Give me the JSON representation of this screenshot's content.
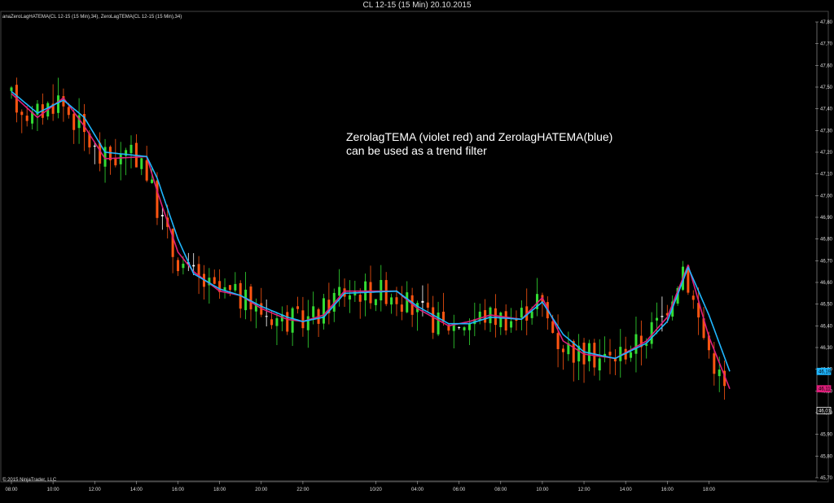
{
  "window": {
    "title": "CL 12-15 (15 Min)  20.10.2015"
  },
  "indicator_label": "anaZeroLagHATEMA(CL 12-15 (15 Min),34), ZeroLagTEMA(CL 12-15 (15 Min),34)",
  "copyright": "© 2015 NinjaTrader, LLC",
  "annotation": {
    "line1": "ZerolagTEMA (violet red) and ZerolagHATEMA(blue)",
    "line2": "can be used as a trend filter"
  },
  "colors": {
    "background": "#000000",
    "up_candle": "#33dd33",
    "down_candle": "#ff5511",
    "doji_candle": "#ffffff",
    "tema_line": "#dd1f7a",
    "hatema_line": "#1fb6ff",
    "axis": "#aaaaaa"
  },
  "price_markers": [
    {
      "label": "46,19",
      "value": 46.19,
      "color": "#1fb6ff"
    },
    {
      "label": "46,11",
      "value": 46.11,
      "color": "#dd1f7a"
    },
    {
      "label": "46,01",
      "value": 46.01,
      "color": "#ffffff"
    }
  ],
  "chart_data": {
    "type": "candlestick",
    "title": "CL 12-15 (15 Min)  20.10.2015",
    "ylim": [
      45.7,
      47.8
    ],
    "y_ticks": [
      "47,80",
      "47,70",
      "47,60",
      "47,50",
      "47,40",
      "47,30",
      "47,20",
      "47,10",
      "47,00",
      "46,90",
      "46,80",
      "46,70",
      "46,60",
      "46,50",
      "46,40",
      "46,30",
      "46,20",
      "46,10",
      "46,00",
      "45,90",
      "45,80",
      "45,70"
    ],
    "x_ticks": [
      "08:00",
      "10:00",
      "12:00",
      "14:00",
      "16:00",
      "18:00",
      "20:00",
      "22:00",
      "10/20",
      "04:00",
      "06:00",
      "08:00",
      "10:00",
      "12:00",
      "14:00",
      "16:00",
      "18:00"
    ],
    "x_tick_bars": [
      0,
      8,
      16,
      24,
      32,
      40,
      48,
      56,
      70,
      78,
      86,
      94,
      102,
      110,
      118,
      126,
      134
    ],
    "n_bars": 138,
    "tema_anchors": [
      [
        0,
        47.47
      ],
      [
        5,
        47.36
      ],
      [
        10,
        47.45
      ],
      [
        14,
        47.32
      ],
      [
        18,
        47.17
      ],
      [
        26,
        47.18
      ],
      [
        28,
        47.02
      ],
      [
        32,
        46.74
      ],
      [
        35,
        46.65
      ],
      [
        40,
        46.56
      ],
      [
        44,
        46.54
      ],
      [
        48,
        46.48
      ],
      [
        53,
        46.43
      ],
      [
        56,
        46.42
      ],
      [
        60,
        46.45
      ],
      [
        64,
        46.56
      ],
      [
        74,
        46.56
      ],
      [
        78,
        46.48
      ],
      [
        84,
        46.4
      ],
      [
        88,
        46.42
      ],
      [
        92,
        46.45
      ],
      [
        98,
        46.43
      ],
      [
        102,
        46.53
      ],
      [
        106,
        46.33
      ],
      [
        110,
        46.27
      ],
      [
        116,
        46.25
      ],
      [
        122,
        46.33
      ],
      [
        126,
        46.44
      ],
      [
        130,
        46.68
      ],
      [
        134,
        46.35
      ],
      [
        138,
        46.11
      ]
    ],
    "hatema_anchors": [
      [
        0,
        47.48
      ],
      [
        5,
        47.38
      ],
      [
        10,
        47.44
      ],
      [
        14,
        47.36
      ],
      [
        18,
        47.2
      ],
      [
        26,
        47.18
      ],
      [
        28,
        47.08
      ],
      [
        32,
        46.8
      ],
      [
        35,
        46.64
      ],
      [
        40,
        46.57
      ],
      [
        44,
        46.54
      ],
      [
        48,
        46.49
      ],
      [
        53,
        46.44
      ],
      [
        56,
        46.42
      ],
      [
        60,
        46.44
      ],
      [
        64,
        46.55
      ],
      [
        74,
        46.56
      ],
      [
        78,
        46.49
      ],
      [
        84,
        46.41
      ],
      [
        88,
        46.41
      ],
      [
        92,
        46.44
      ],
      [
        98,
        46.43
      ],
      [
        102,
        46.51
      ],
      [
        106,
        46.36
      ],
      [
        110,
        46.28
      ],
      [
        116,
        46.25
      ],
      [
        122,
        46.32
      ],
      [
        126,
        46.42
      ],
      [
        130,
        46.67
      ],
      [
        134,
        46.45
      ],
      [
        138,
        46.19
      ]
    ],
    "last_prices": {
      "hatema": 46.19,
      "tema": 46.11,
      "close": 46.01
    }
  }
}
